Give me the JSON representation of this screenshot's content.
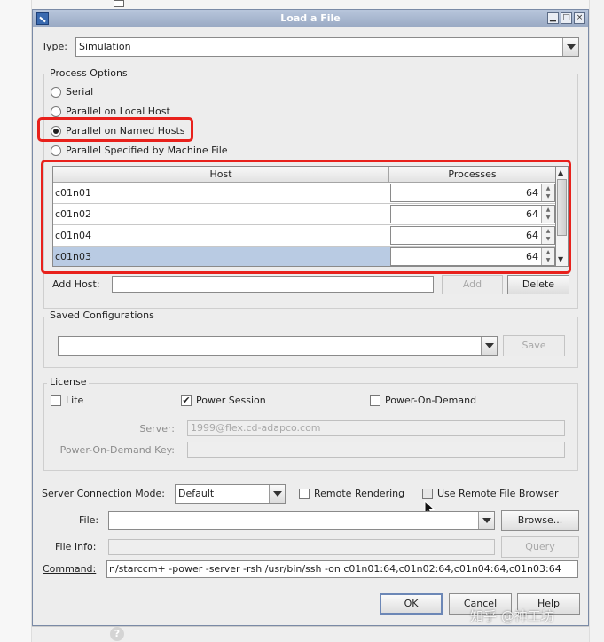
{
  "dialog": {
    "title": "Load a File",
    "min_label": "▁",
    "max_label": "□",
    "close_label": "×"
  },
  "type": {
    "label": "Type:",
    "value": "Simulation"
  },
  "process_options": {
    "title": "Process Options",
    "options": [
      {
        "label": "Serial",
        "selected": false
      },
      {
        "label": "Parallel on Local Host",
        "selected": false
      },
      {
        "label": "Parallel on Named Hosts",
        "selected": true
      },
      {
        "label": "Parallel Specified by Machine File",
        "selected": false
      }
    ],
    "hosts_table": {
      "columns": [
        "Host",
        "Processes"
      ],
      "rows": [
        {
          "host": "c01n01",
          "processes": "64"
        },
        {
          "host": "c01n02",
          "processes": "64"
        },
        {
          "host": "c01n04",
          "processes": "64"
        },
        {
          "host": "c01n03",
          "processes": "64"
        }
      ],
      "selected_row": 3
    },
    "add_host_label": "Add Host:",
    "add_host_value": "",
    "add_button": "Add",
    "delete_button": "Delete"
  },
  "saved_configurations": {
    "title": "Saved Configurations",
    "value": "",
    "save_button": "Save"
  },
  "license": {
    "title": "License",
    "lite_label": "Lite",
    "lite_checked": false,
    "power_session_label": "Power Session",
    "power_session_checked": true,
    "power_on_demand_label": "Power-On-Demand",
    "power_on_demand_checked": false,
    "server_label": "Server:",
    "server_value": "1999@flex.cd-adapco.com",
    "pod_key_label": "Power-On-Demand Key:",
    "pod_key_value": ""
  },
  "connection": {
    "mode_label": "Server Connection Mode:",
    "mode_value": "Default",
    "remote_rendering_label": "Remote Rendering",
    "remote_file_browser_label": "Use Remote File Browser"
  },
  "file": {
    "label": "File:",
    "value": "",
    "browse_button": "Browse...",
    "info_label": "File Info:",
    "info_value": "",
    "query_button": "Query"
  },
  "command": {
    "label": "Command:",
    "value": "n/starccm+ -power -server -rsh /usr/bin/ssh -on c01n01:64,c01n02:64,c01n04:64,c01n03:64"
  },
  "footer": {
    "ok_button": "OK",
    "cancel_button": "Cancel",
    "help_button": "Help"
  },
  "watermark": "知乎 @神工坊",
  "colors": {
    "highlight": "#e8211c",
    "selection": "#b9cbe3",
    "titlebar": "#9aaac4"
  }
}
